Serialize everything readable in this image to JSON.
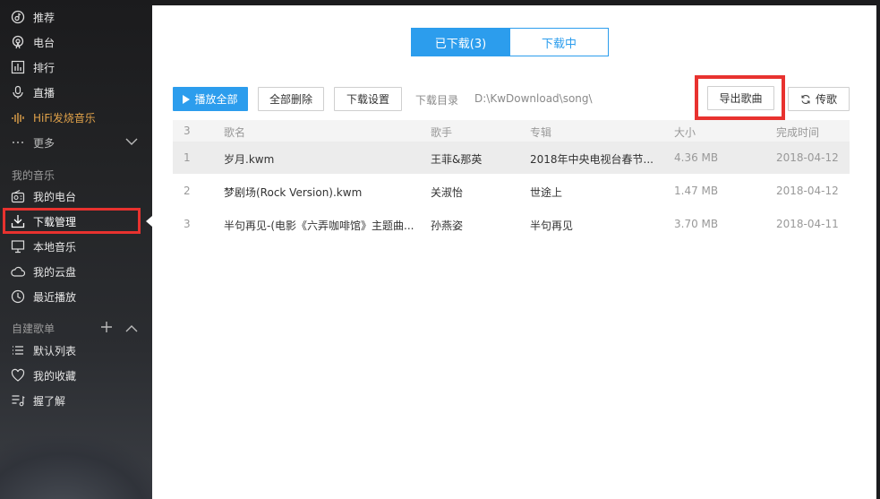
{
  "sidebar": {
    "items": [
      {
        "label": "推荐",
        "icon": "music-note-icon"
      },
      {
        "label": "电台",
        "icon": "radio-icon"
      },
      {
        "label": "排行",
        "icon": "chart-bar-icon"
      },
      {
        "label": "直播",
        "icon": "microphone-icon"
      },
      {
        "label": "HiFi发烧音乐",
        "icon": "hifi-wave-icon"
      },
      {
        "label": "更多",
        "icon": "ellipsis-icon"
      }
    ],
    "my_music_title": "我的音乐",
    "my_music": [
      {
        "label": "我的电台",
        "icon": "radio-box-icon"
      },
      {
        "label": "下载管理",
        "icon": "download-icon"
      },
      {
        "label": "本地音乐",
        "icon": "monitor-icon"
      },
      {
        "label": "我的云盘",
        "icon": "cloud-icon"
      },
      {
        "label": "最近播放",
        "icon": "clock-icon"
      }
    ],
    "playlists_title": "自建歌单",
    "playlists": [
      {
        "label": "默认列表",
        "icon": "list-icon"
      },
      {
        "label": "我的收藏",
        "icon": "heart-icon"
      },
      {
        "label": "握了解",
        "icon": "playlist-icon"
      }
    ]
  },
  "tabs": [
    {
      "label": "已下载(3)",
      "active": true
    },
    {
      "label": "下载中",
      "active": false
    }
  ],
  "toolbar": {
    "play_all": "播放全部",
    "delete_all": "全部删除",
    "download_settings": "下载设置",
    "dir_label": "下载目录",
    "dir_path": "D:\\KwDownload\\song\\",
    "export": "导出歌曲",
    "transfer": "传歌"
  },
  "table": {
    "headers": {
      "count": "3",
      "name": "歌名",
      "artist": "歌手",
      "album": "专辑",
      "size": "大小",
      "date": "完成时间"
    },
    "rows": [
      {
        "idx": "1",
        "name": "岁月.kwm",
        "artist": "王菲&那英",
        "album": "2018年中央电视台春节...",
        "size": "4.36 MB",
        "date": "2018-04-12",
        "selected": true
      },
      {
        "idx": "2",
        "name": "梦剧场(Rock Version).kwm",
        "artist": "关淑怡",
        "album": "世途上",
        "size": "1.47 MB",
        "date": "2018-04-12",
        "selected": false
      },
      {
        "idx": "3",
        "name": "半句再见-(电影《六弄咖啡馆》主题曲...",
        "artist": "孙燕姿",
        "album": "半句再见",
        "size": "3.70 MB",
        "date": "2018-04-11",
        "selected": false
      }
    ]
  },
  "colors": {
    "accent": "#2c9ded",
    "highlight": "#e8322f",
    "hifi": "#e0a24a"
  }
}
